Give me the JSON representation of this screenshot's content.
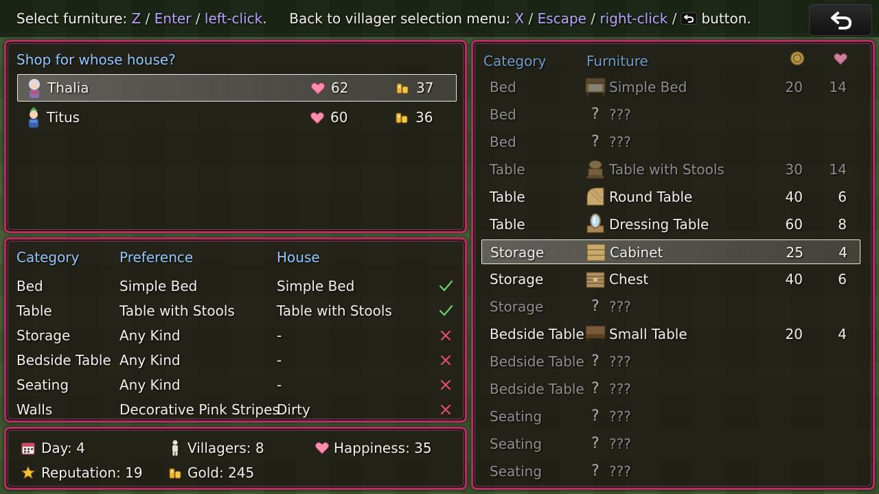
{
  "top_hint": {
    "select_label": "Select furniture:",
    "select_keys": [
      "Z",
      "Enter",
      "left-click"
    ],
    "back_label": "Back to villager selection menu:",
    "back_keys": [
      "X",
      "Escape",
      "right-click"
    ],
    "button_word": "button.",
    "sep": "/",
    "period": "."
  },
  "villager_panel": {
    "title": "Shop for whose house?",
    "villagers": [
      {
        "name": "Thalia",
        "happiness": "62",
        "gold": "37",
        "selected": true
      },
      {
        "name": "Titus",
        "happiness": "60",
        "gold": "36",
        "selected": false
      }
    ]
  },
  "preference_panel": {
    "headers": {
      "category": "Category",
      "preference": "Preference",
      "house": "House"
    },
    "rows": [
      {
        "category": "Bed",
        "preference": "Simple Bed",
        "house": "Simple Bed",
        "status": "match"
      },
      {
        "category": "Table",
        "preference": "Table with Stools",
        "house": "Table with Stools",
        "status": "match"
      },
      {
        "category": "Storage",
        "preference": "Any Kind",
        "house": "-",
        "status": "missing"
      },
      {
        "category": "Bedside Table",
        "preference": "Any Kind",
        "house": "-",
        "status": "missing"
      },
      {
        "category": "Seating",
        "preference": "Any Kind",
        "house": "-",
        "status": "missing"
      },
      {
        "category": "Walls",
        "preference": "Decorative Pink Stripes",
        "house": "Dirty",
        "status": "missing"
      }
    ],
    "status_icons": {
      "match": "checkmark-icon",
      "missing": "cross-icon"
    }
  },
  "status_panel": {
    "day": "Day: 4",
    "villagers": "Villagers: 8",
    "happiness": "Happiness: 35",
    "reputation": "Reputation: 19",
    "gold": "Gold: 245"
  },
  "furniture_panel": {
    "headers": {
      "category": "Category",
      "furniture": "Furniture",
      "cost_icon": "coin-icon",
      "happiness_icon": "heart-icon"
    },
    "items": [
      {
        "category": "Bed",
        "name": "Simple Bed",
        "icon": "bed-icon",
        "cost": "20",
        "happiness": "14",
        "state": "owned"
      },
      {
        "category": "Bed",
        "name": "???",
        "icon": "unknown-icon",
        "cost": "",
        "happiness": "",
        "state": "locked"
      },
      {
        "category": "Bed",
        "name": "???",
        "icon": "unknown-icon",
        "cost": "",
        "happiness": "",
        "state": "locked"
      },
      {
        "category": "Table",
        "name": "Table with Stools",
        "icon": "table-stools-icon",
        "cost": "30",
        "happiness": "14",
        "state": "owned"
      },
      {
        "category": "Table",
        "name": "Round Table",
        "icon": "round-table-icon",
        "cost": "40",
        "happiness": "6",
        "state": "available"
      },
      {
        "category": "Table",
        "name": "Dressing Table",
        "icon": "dressing-table-icon",
        "cost": "60",
        "happiness": "8",
        "state": "available"
      },
      {
        "category": "Storage",
        "name": "Cabinet",
        "icon": "cabinet-icon",
        "cost": "25",
        "happiness": "4",
        "state": "selected"
      },
      {
        "category": "Storage",
        "name": "Chest",
        "icon": "chest-icon",
        "cost": "40",
        "happiness": "6",
        "state": "available"
      },
      {
        "category": "Storage",
        "name": "???",
        "icon": "unknown-icon",
        "cost": "",
        "happiness": "",
        "state": "locked"
      },
      {
        "category": "Bedside Table",
        "name": "Small Table",
        "icon": "small-table-icon",
        "cost": "20",
        "happiness": "4",
        "state": "available"
      },
      {
        "category": "Bedside Table",
        "name": "???",
        "icon": "unknown-icon",
        "cost": "",
        "happiness": "",
        "state": "locked"
      },
      {
        "category": "Bedside Table",
        "name": "???",
        "icon": "unknown-icon",
        "cost": "",
        "happiness": "",
        "state": "locked"
      },
      {
        "category": "Seating",
        "name": "???",
        "icon": "unknown-icon",
        "cost": "",
        "happiness": "",
        "state": "locked"
      },
      {
        "category": "Seating",
        "name": "???",
        "icon": "unknown-icon",
        "cost": "",
        "happiness": "",
        "state": "locked"
      },
      {
        "category": "Seating",
        "name": "???",
        "icon": "unknown-icon",
        "cost": "",
        "happiness": "",
        "state": "locked"
      }
    ]
  },
  "colors": {
    "accent_key": "#b9a3ff",
    "heading": "#8fc8ff",
    "border": "#b0305f",
    "check": "#6fd36f",
    "cross": "#e0506a",
    "dim": "#8a8a8a",
    "heart": "#ff8fb0",
    "gold": "#e8b93a"
  },
  "unknown_glyph": "?"
}
